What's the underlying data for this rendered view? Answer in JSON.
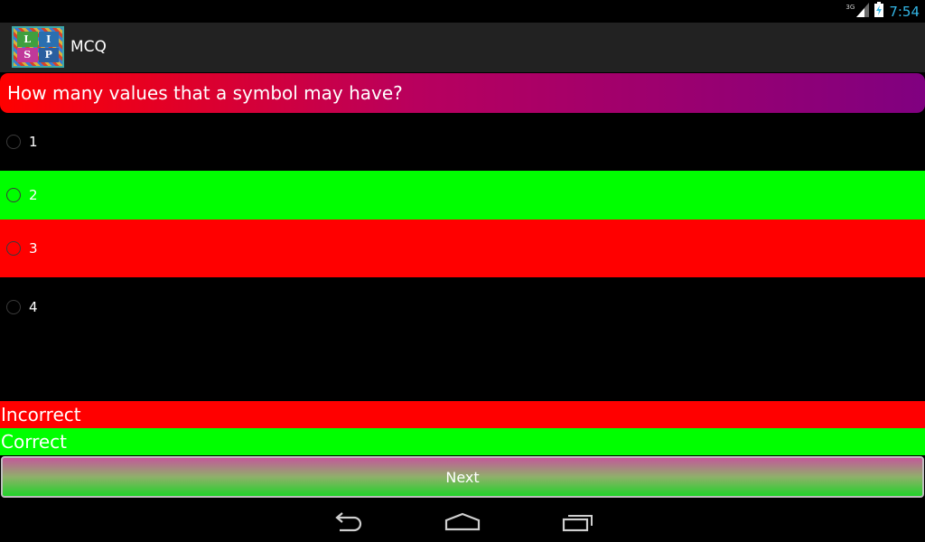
{
  "status_bar": {
    "network_type": "3G",
    "time": "7:54"
  },
  "action_bar": {
    "title": "MCQ",
    "icon_letters": [
      "L",
      "I",
      "S",
      "P"
    ]
  },
  "question": {
    "text": "How many values that a symbol may have?"
  },
  "options": [
    {
      "label": "1",
      "state": "none",
      "color": "#000000"
    },
    {
      "label": "2",
      "state": "correct",
      "color": "#00ff00"
    },
    {
      "label": "3",
      "state": "incorrect",
      "color": "#ff0000"
    },
    {
      "label": "4",
      "state": "none",
      "color": "#000000"
    }
  ],
  "result": {
    "incorrect_label": "Incorrect",
    "correct_label": "Correct",
    "incorrect_color": "#ff0000",
    "correct_color": "#00ff00"
  },
  "next_button": {
    "label": "Next"
  },
  "navigation": {
    "icons": [
      "back-icon",
      "home-icon",
      "recents-icon"
    ]
  },
  "colors": {
    "clock": "#33b5e5",
    "banner_start": "#ff0000",
    "banner_end": "#800080"
  }
}
